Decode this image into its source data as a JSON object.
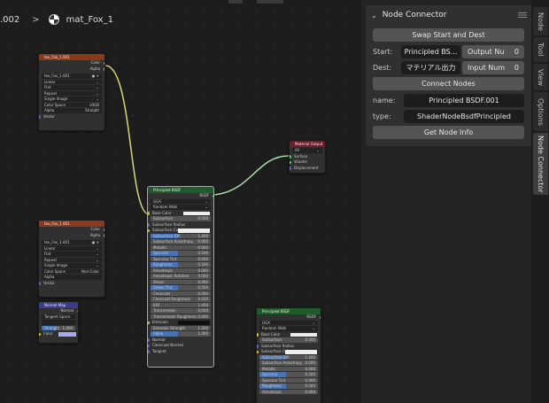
{
  "breadcrumb": {
    "left": ".002",
    "material": "mat_Fox_1"
  },
  "nodes": {
    "tex1": {
      "title": "tex_Fox_1.001",
      "outs": [
        "Color",
        "Alpha"
      ],
      "image": "tex_Fox_1.001",
      "props": [
        [
          "Linear",
          ""
        ],
        [
          "Flat",
          ""
        ],
        [
          "Repeat",
          ""
        ],
        [
          "Single Image",
          ""
        ],
        [
          "Color Space",
          "sRGB"
        ],
        [
          "Alpha",
          "Straight"
        ]
      ],
      "vector": "Vector"
    },
    "tex2": {
      "title": "tex_Fox_1.001",
      "outs": [
        "Color",
        "Alpha"
      ],
      "image": "tex_Fox_1.001",
      "props": [
        [
          "Linear",
          ""
        ],
        [
          "Flat",
          ""
        ],
        [
          "Repeat",
          ""
        ],
        [
          "Single Image",
          ""
        ],
        [
          "Color Space",
          "Non-Color"
        ],
        [
          "Alpha",
          ""
        ]
      ],
      "vector": "Vector"
    },
    "normal": {
      "title": "Normal Map",
      "out": "Normal",
      "space": "Tangent Space",
      "uv": "",
      "strength_label": "Strength",
      "strength": "1.000",
      "color": "Color"
    },
    "output": {
      "title": "Material Output",
      "target": "All",
      "inputs": [
        "Surface",
        "Volume",
        "Displacement"
      ]
    },
    "bsdf1": {
      "title": "Principled BSDF",
      "out": "BSDF",
      "dist": "GGX",
      "sss": "Random Walk",
      "rows": [
        [
          "Base Color",
          ""
        ],
        [
          "Subsurface",
          "0.000"
        ],
        [
          "Subsurface Radius",
          ""
        ],
        [
          "Subsurface Color",
          ""
        ],
        [
          "Subsurface IOR",
          "1.400"
        ],
        [
          "Subsurface Anisotropy",
          "0.000"
        ],
        [
          "Metallic",
          "0.000"
        ],
        [
          "Specular",
          "0.500"
        ],
        [
          "Specular Tint",
          "0.000"
        ],
        [
          "Roughness",
          "0.500"
        ],
        [
          "Anisotropic",
          "0.000"
        ],
        [
          "Anisotropic Rotation",
          "0.000"
        ],
        [
          "Sheen",
          "0.000"
        ],
        [
          "Sheen Tint",
          "0.500"
        ],
        [
          "Clearcoat",
          "0.000"
        ],
        [
          "Clearcoat Roughness",
          "0.030"
        ],
        [
          "IOR",
          "1.450"
        ],
        [
          "Transmission",
          "0.000"
        ],
        [
          "Transmission Roughness",
          "0.000"
        ],
        [
          "Emission",
          ""
        ],
        [
          "Emission Strength",
          "1.000"
        ],
        [
          "Alpha",
          "1.000"
        ],
        [
          "Normal",
          ""
        ],
        [
          "Clearcoat Normal",
          ""
        ],
        [
          "Tangent",
          ""
        ]
      ]
    },
    "bsdf2": {
      "title": "Principled BSDF",
      "out": "BSDF",
      "dist": "GGX",
      "sss": "Random Walk",
      "rows": [
        [
          "Base Color",
          ""
        ],
        [
          "Subsurface",
          "0.000"
        ],
        [
          "Subsurface Radius",
          ""
        ],
        [
          "Subsurface Color",
          ""
        ],
        [
          "Subsurface IOR",
          "1.400"
        ],
        [
          "Subsurface Anisotropy",
          "0.000"
        ],
        [
          "Metallic",
          "0.000"
        ],
        [
          "Specular",
          "0.500"
        ],
        [
          "Specular Tint",
          "0.000"
        ],
        [
          "Roughness",
          "0.500"
        ],
        [
          "Anisotropic",
          "0.000"
        ]
      ]
    }
  },
  "panel": {
    "title": "Node Connector",
    "swap_label": "Swap Start and Dest",
    "start_label": "Start:",
    "start_node": "Principled BS...",
    "start_socket": "Output Nu",
    "start_num": "0",
    "dest_label": "Dest:",
    "dest_node": "マテリアル出力",
    "dest_socket": "Input Num",
    "dest_num": "0",
    "connect_label": "Connect Nodes",
    "name_label": "name:",
    "name_value": "Principled BSDF.001",
    "type_label": "type:",
    "type_value": "ShaderNodeBsdfPrincipled",
    "info_label": "Get Node Info"
  },
  "tabs": [
    "Node",
    "Tool",
    "View",
    "Options",
    "Node Connector"
  ],
  "colors": {
    "tex_header": "#8a3a1a",
    "bsdf_header": "#1f5a2a",
    "output_header": "#6e1c2a",
    "normal_header": "#3c3c8a",
    "wire": "#d8d87a",
    "wire2": "#a8dba8"
  }
}
